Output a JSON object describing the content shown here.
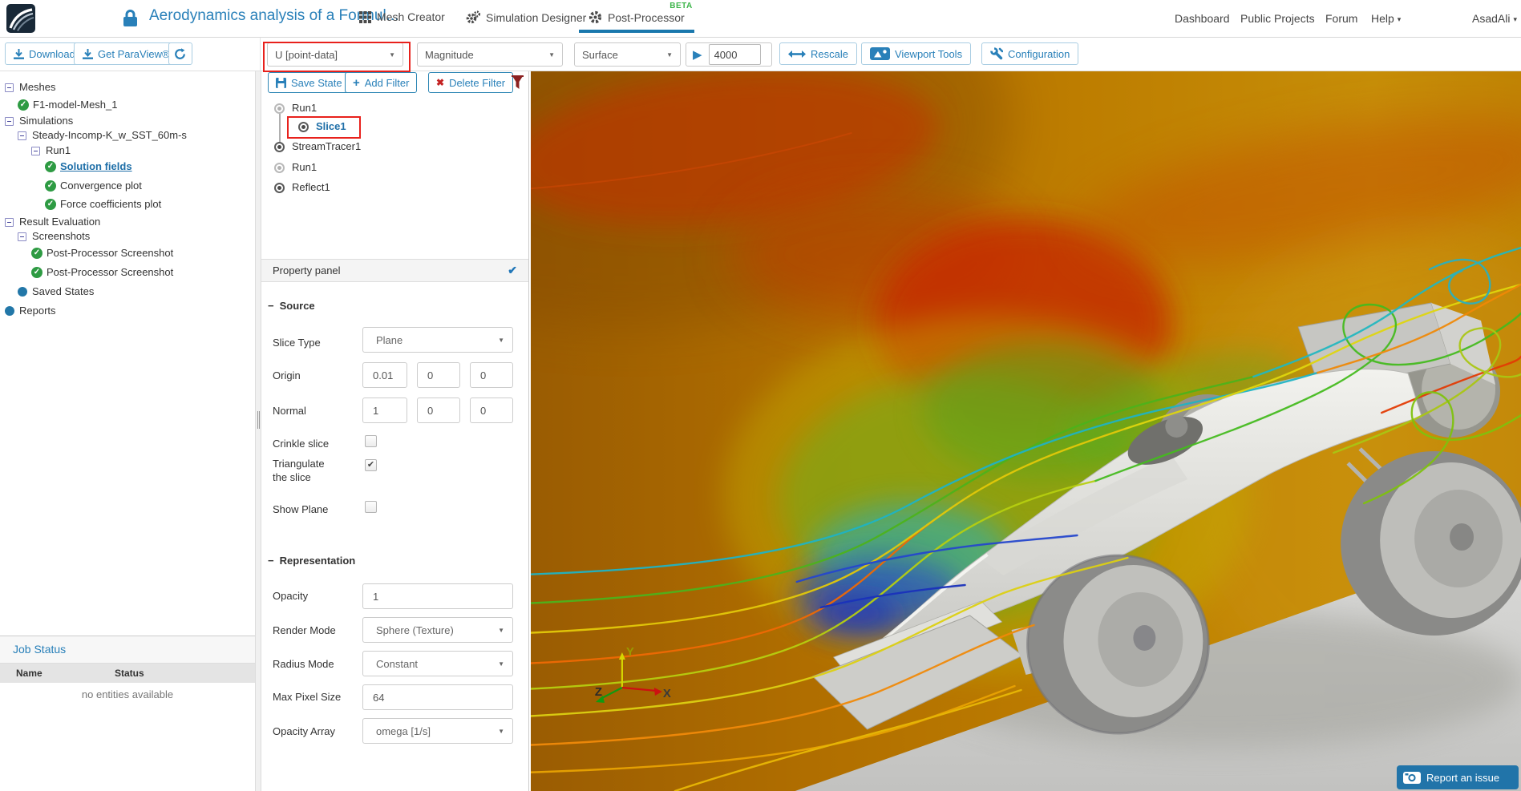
{
  "header": {
    "title": "Aerodynamics analysis of a Formul...",
    "tabs": [
      {
        "label": "Mesh Creator"
      },
      {
        "label": "Simulation Designer"
      },
      {
        "label": "Post-Processor",
        "badge": "BETA"
      }
    ],
    "nav": [
      "Dashboard",
      "Public Projects",
      "Forum",
      "Help"
    ],
    "user": "AsadAli"
  },
  "toolbar": {
    "download_label": "Download",
    "paraview_label": "Get ParaView®",
    "field_select": "U [point-data]",
    "component_select": "Magnitude",
    "representation_select": "Surface",
    "frame_value": "4000",
    "rescale_label": "Rescale",
    "viewport_tools_label": "Viewport Tools",
    "configuration_label": "Configuration"
  },
  "sidebar": {
    "tree": [
      {
        "label": "Meshes"
      },
      {
        "label": "F1-model-Mesh_1"
      },
      {
        "label": "Simulations"
      },
      {
        "label": "Steady-Incomp-K_w_SST_60m-s"
      },
      {
        "label": "Run1"
      },
      {
        "label": "Solution fields"
      },
      {
        "label": "Convergence plot"
      },
      {
        "label": "Force coefficients plot"
      },
      {
        "label": "Result Evaluation"
      },
      {
        "label": "Screenshots"
      },
      {
        "label": "Post-Processor Screenshot"
      },
      {
        "label": "Post-Processor Screenshot"
      },
      {
        "label": "Saved States"
      },
      {
        "label": "Reports"
      }
    ],
    "job_status": {
      "title": "Job Status",
      "name_col": "Name",
      "status_col": "Status",
      "empty_text": "no entities available"
    }
  },
  "filter_panel": {
    "save_state_label": "Save State",
    "add_filter_label": "Add Filter",
    "delete_filter_label": "Delete Filter",
    "pipeline": [
      {
        "label": "Run1"
      },
      {
        "label": "Slice1"
      },
      {
        "label": "StreamTracer1"
      },
      {
        "label": "Run1"
      },
      {
        "label": "Reflect1"
      }
    ]
  },
  "property_panel": {
    "title": "Property panel",
    "source_title": "Source",
    "slice_type_label": "Slice Type",
    "slice_type_value": "Plane",
    "origin_label": "Origin",
    "origin_values": [
      "0.01",
      "0",
      "0"
    ],
    "normal_label": "Normal",
    "normal_values": [
      "1",
      "0",
      "0"
    ],
    "crinkle_label": "Crinkle slice",
    "triangulate_label_1": "Triangulate",
    "triangulate_label_2": "the slice",
    "show_plane_label": "Show Plane",
    "representation_title": "Representation",
    "opacity_label": "Opacity",
    "opacity_value": "1",
    "render_mode_label": "Render Mode",
    "render_mode_value": "Sphere (Texture)",
    "radius_mode_label": "Radius Mode",
    "radius_mode_value": "Constant",
    "max_pixel_label": "Max Pixel Size",
    "max_pixel_value": "64",
    "opacity_array_label": "Opacity Array",
    "opacity_array_value": "omega [1/s]"
  },
  "viewport": {
    "axis_x": "X",
    "axis_y": "Y",
    "axis_z": "Z",
    "report_issue_label": "Report an issue"
  },
  "icons": {
    "caret": "▼",
    "caret_small": "▾",
    "check": "✓",
    "checkbox_check": "✔",
    "panel_check": "✔",
    "plus": "+",
    "delete_x": "✖",
    "play": "▶",
    "minus": "−"
  },
  "colors": {
    "accent_blue": "#2980b9",
    "highlight_red": "#e8211c",
    "beta_green": "#3db54a",
    "check_green": "#2e9b43",
    "slice_orange": "#bd7d00",
    "slice_red": "#c52b00",
    "wake_blue": "#2545cc",
    "wake_green": "#6fae1e",
    "ground_gray": "#cfcfcd"
  }
}
